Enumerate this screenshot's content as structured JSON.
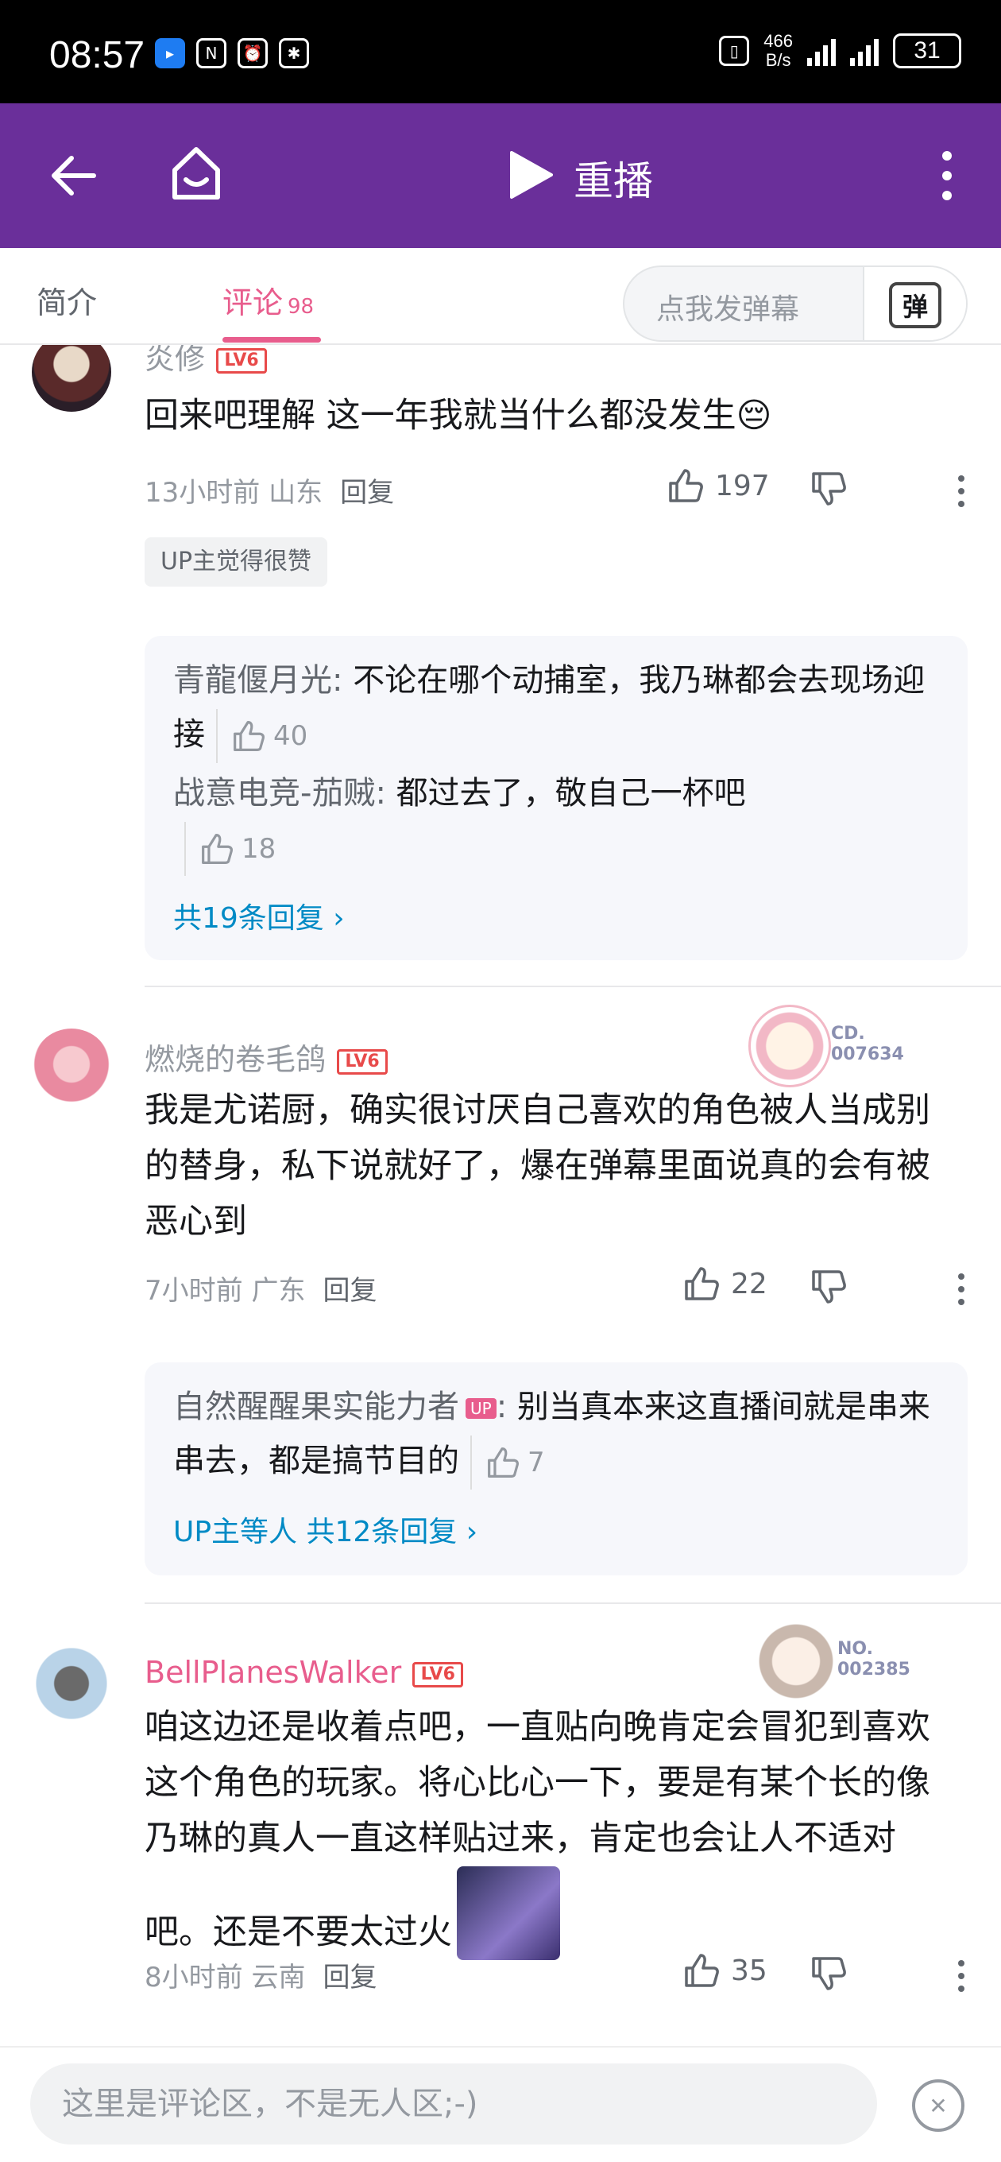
{
  "status_bar": {
    "time": "08:57",
    "net_speed_top": "466",
    "net_speed_bottom": "B/s",
    "battery": "31"
  },
  "top_bar": {
    "title": "重播",
    "background": "#6a2f9a"
  },
  "tabs": [
    {
      "label": "简介",
      "count": ""
    },
    {
      "label": "评论",
      "count": "98"
    }
  ],
  "danmaku": {
    "placeholder": "点我发弹幕",
    "button_label": "弹"
  },
  "comments": [
    {
      "username": "炎修",
      "level": "LV6",
      "text": "回来吧理解 这一年我就当什么都没发生😔",
      "time_location": "13小时前 山东",
      "reply_label": "回复",
      "likes": "197",
      "tag": "UP主觉得很赞",
      "sub_replies": [
        {
          "name": "青龍偃月光",
          "text": "不论在哪个动捕室，我乃琳都会去现场迎接",
          "likes": "40"
        },
        {
          "name": "战意电竞-茄贼",
          "text": "都过去了，敬自己一杯吧",
          "likes": "18"
        }
      ],
      "more_replies": "共19条回复 ›"
    },
    {
      "username": "燃烧的卷毛鸽",
      "level": "LV6",
      "badge_number": "CD. 007634",
      "text": "我是尤诺厨，确实很讨厌自己喜欢的角色被人当成别的替身，私下说就好了，爆在弹幕里面说真的会有被恶心到",
      "time_location": "7小时前 广东",
      "reply_label": "回复",
      "likes": "22",
      "sub_replies": [
        {
          "name": "自然醒醒果实能力者",
          "up": "UP",
          "text": "别当真本来这直播间就是串来串去，都是搞节目的",
          "likes": "7"
        }
      ],
      "more_replies": "UP主等人 共12条回复 ›"
    },
    {
      "username": "BellPlanesWalker",
      "level": "LV6",
      "badge_number": "NO. 002385",
      "text": "咱这边还是收着点吧，一直贴向晚肯定会冒犯到喜欢这个角色的玩家。将心比心一下，要是有某个长的像乃琳的真人一直这样贴过来，肯定也会让人不适对吧。还是不要太过火",
      "time_location": "8小时前 云南",
      "reply_label": "回复",
      "likes": "35"
    }
  ],
  "bottom_input": {
    "placeholder": "这里是评论区，不是无人区;-)"
  }
}
